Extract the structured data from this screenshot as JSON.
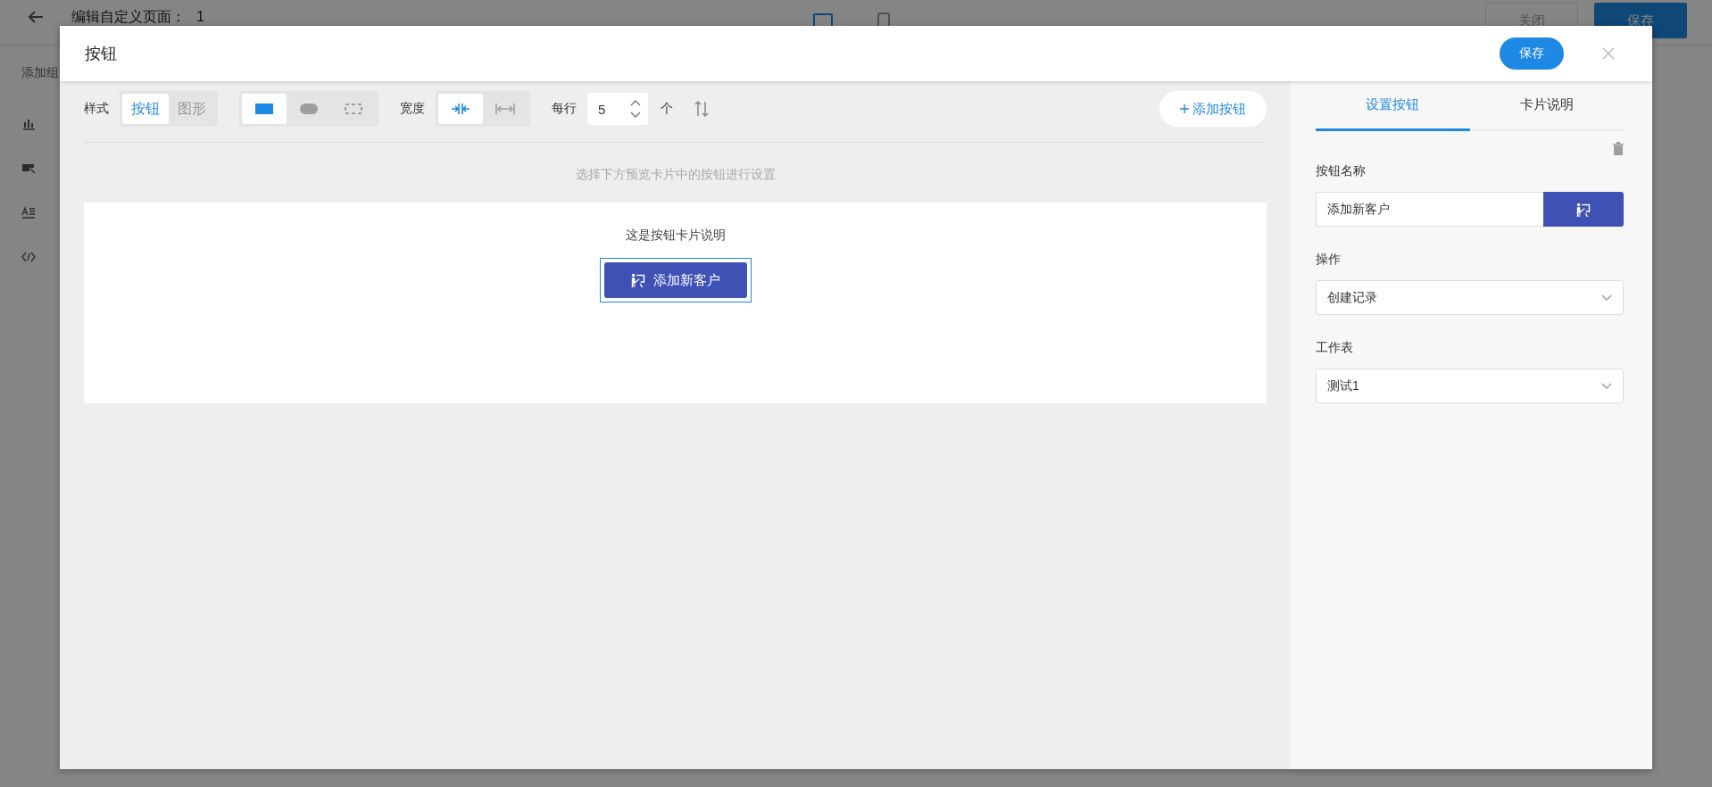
{
  "background_page": {
    "title": "编辑自定义页面：",
    "page_name": "1",
    "view_modes": [
      {
        "kind": "desktop",
        "selected": true
      },
      {
        "kind": "mobile",
        "selected": false
      }
    ],
    "buttons": [
      {
        "label": "关闭",
        "kind": "secondary"
      },
      {
        "label": "保存",
        "kind": "primary"
      }
    ],
    "sidebar": {
      "heading": "添加组",
      "items": [
        {
          "kind": "chart"
        },
        {
          "kind": "button"
        },
        {
          "kind": "richtext"
        },
        {
          "kind": "embed"
        }
      ]
    }
  },
  "dialog": {
    "title": "按钮",
    "save_button": "保存",
    "toolbar": {
      "style_label": "样式",
      "style_options": [
        {
          "label": "按钮",
          "selected": true
        },
        {
          "label": "图形",
          "selected": false
        }
      ],
      "shapes": [
        {
          "kind": "filled",
          "selected": true
        },
        {
          "kind": "pill",
          "selected": false
        },
        {
          "kind": "outline",
          "selected": false
        }
      ],
      "width_label": "宽度",
      "widths": [
        {
          "kind": "compact",
          "selected": true
        },
        {
          "kind": "full",
          "selected": false
        }
      ],
      "per_row_label": "每行",
      "per_row": "5",
      "per_row_unit": "个",
      "add_button": "添加按钮"
    },
    "hint": "选择下方预览卡片中的按钮进行设置",
    "preview": {
      "description": "这是按钮卡片说明",
      "buttons": [
        {
          "label": "添加新客户",
          "selected": true
        }
      ]
    },
    "settings": {
      "tabs": [
        {
          "label": "设置按钮",
          "selected": true
        },
        {
          "label": "卡片说明",
          "selected": false
        }
      ],
      "name_label": "按钮名称",
      "name_value": "添加新客户",
      "action_label": "操作",
      "action_value": "创建记录",
      "sheet_label": "工作表",
      "sheet_value": "测试1"
    }
  }
}
